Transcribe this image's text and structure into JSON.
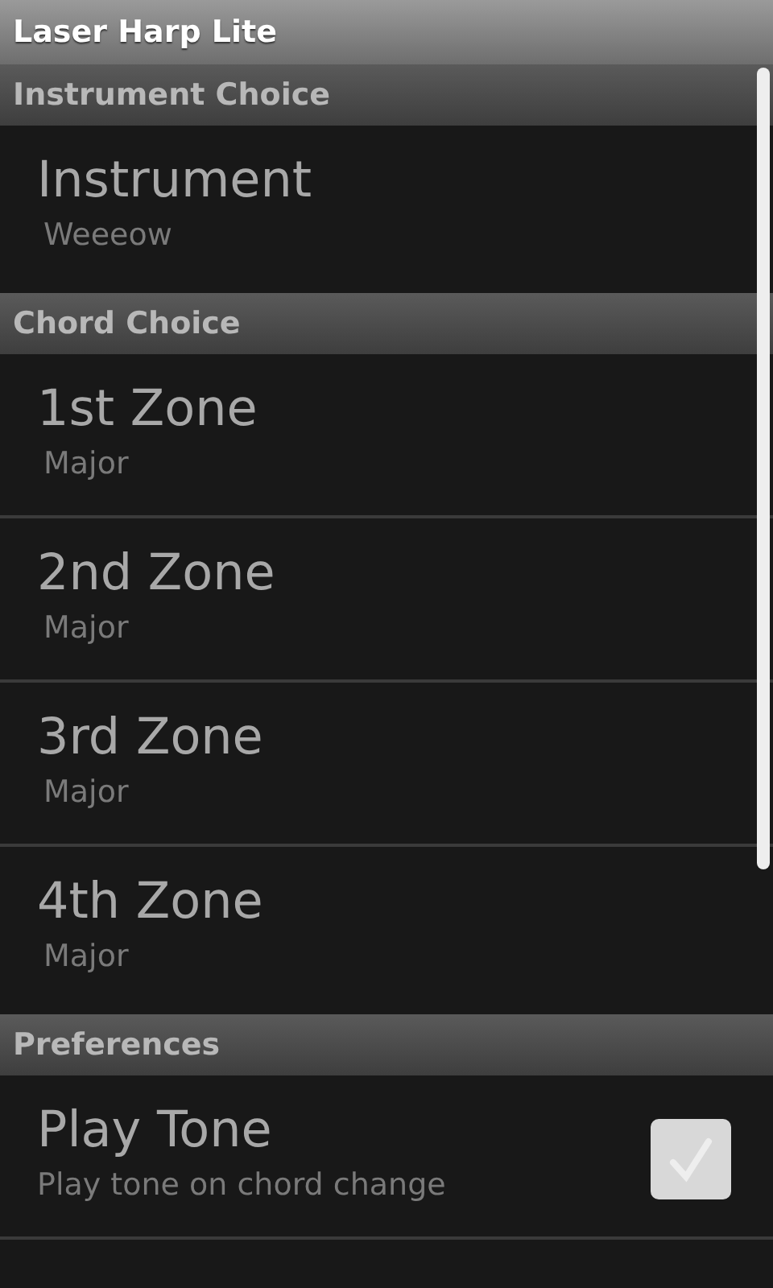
{
  "window": {
    "title": "Laser Harp Lite"
  },
  "sections": [
    {
      "header": "Instrument Choice",
      "items": [
        {
          "kind": "list",
          "title": "Instrument",
          "summary": "Weeeow"
        }
      ]
    },
    {
      "header": "Chord Choice",
      "items": [
        {
          "kind": "list",
          "title": "1st Zone",
          "summary": "Major"
        },
        {
          "kind": "list",
          "title": "2nd Zone",
          "summary": "Major"
        },
        {
          "kind": "list",
          "title": "3rd Zone",
          "summary": "Major"
        },
        {
          "kind": "list",
          "title": "4th Zone",
          "summary": "Major"
        }
      ]
    },
    {
      "header": "Preferences",
      "items": [
        {
          "kind": "checkbox",
          "title": "Play Tone",
          "summary": "Play tone on chord change",
          "checked": true
        }
      ]
    }
  ]
}
